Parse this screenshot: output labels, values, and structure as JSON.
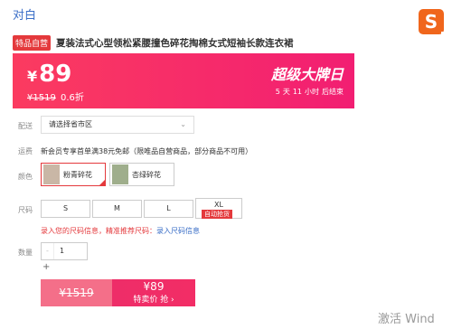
{
  "header": {
    "brand": "对白",
    "logo_letter": "S"
  },
  "product": {
    "badge": "特品自营",
    "title": "夏装法式心型领松紧腰撞色碎花掏棉女式短袖长款连衣裙"
  },
  "price": {
    "currency": "¥",
    "current": "89",
    "original": "¥1519",
    "discount": "0.6折",
    "promo_title": "超级大牌日",
    "countdown": [
      "5",
      "天",
      "11",
      "小时",
      "后结束"
    ]
  },
  "delivery": {
    "label": "配送",
    "select_value": "请选择省市区"
  },
  "shipping": {
    "label": "运费",
    "text": "新会员专享首单满38元免邮（限唯品自营商品，部分商品不可用）"
  },
  "colors": {
    "label": "颜色",
    "options": [
      {
        "name": "粉青碎花",
        "selected": true,
        "color": "#c9b7a6"
      },
      {
        "name": "杏绿碎花",
        "selected": false,
        "color": "#9fae8c"
      }
    ]
  },
  "sizes": {
    "label": "尺码",
    "options": [
      "S",
      "M",
      "L",
      "XL"
    ],
    "xl_tag": "自动抢货",
    "tip_prefix": "录入您的尺码信息，精准推荐尺码：",
    "tip_link": "录入尺码信息"
  },
  "quantity": {
    "label": "数量",
    "minus": "-",
    "value": "1",
    "plus": "+"
  },
  "buy": {
    "original": "¥1519",
    "special_price": "¥89",
    "special_label": "特卖价 抢 ›"
  },
  "watermark": "激活 Wind"
}
